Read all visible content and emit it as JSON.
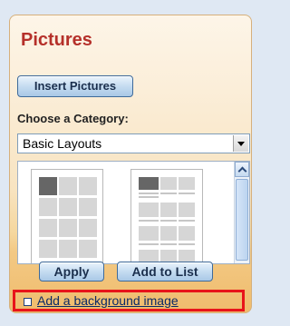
{
  "panel": {
    "title": "Pictures",
    "insert_button_label": "Insert Pictures",
    "category_label": "Choose a Category:",
    "category_selected": "Basic Layouts",
    "apply_label": "Apply",
    "add_to_list_label": "Add to List",
    "background_link_label": "Add a background image"
  },
  "colors": {
    "title": "#b5302a",
    "highlight_border": "#e8141a",
    "button_border": "#3e6a9a"
  }
}
